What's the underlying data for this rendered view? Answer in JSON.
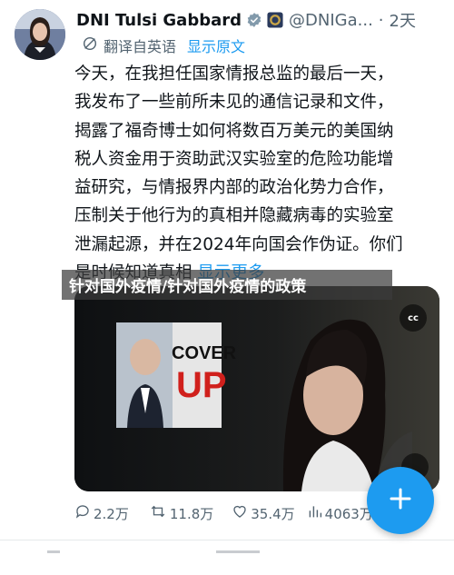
{
  "colors": {
    "link": "#1d9bf0",
    "secondary_text": "#536471",
    "fab": "#1d9bf0"
  },
  "author": {
    "display_name": "DNI Tulsi Gabbard",
    "handle": "@DNIGa...",
    "separator": "·",
    "time": "2天",
    "verified_icon": "verified-badge-icon",
    "affiliation_icon": "government-seal-icon"
  },
  "translation": {
    "icon": "translate-icon",
    "label": "翻译自英语",
    "show_original": "显示原文"
  },
  "tweet": {
    "lines": [
      "今天，在我担任国家情报总监的最后一天，",
      "我发布了一些前所未见的通信记录和文件，",
      "揭露了福奇博士如何将数百万美元的美国纳",
      "税人资金用于资助武汉实验室的危险功能增",
      "益研究，与情报界内部的政治化势力合作，",
      "压制关于他行为的真相并隐藏病毒的实验室",
      "泄漏起源，并在2024年向国会作伪证。你们",
      "是时候知道真相"
    ],
    "show_more": "显示更多"
  },
  "media": {
    "thumbnail_text": "COVER UP",
    "cc_label": "cc"
  },
  "banner": {
    "text": "针对国外疫情/针对国外疫情的政策"
  },
  "actions": [
    {
      "icon": "reply-icon",
      "count": "2.2万"
    },
    {
      "icon": "retweet-icon",
      "count": "11.8万"
    },
    {
      "icon": "like-icon",
      "count": "35.4万"
    },
    {
      "icon": "views-icon",
      "count": "4063万"
    }
  ],
  "fab": {
    "icon": "plus-icon"
  }
}
